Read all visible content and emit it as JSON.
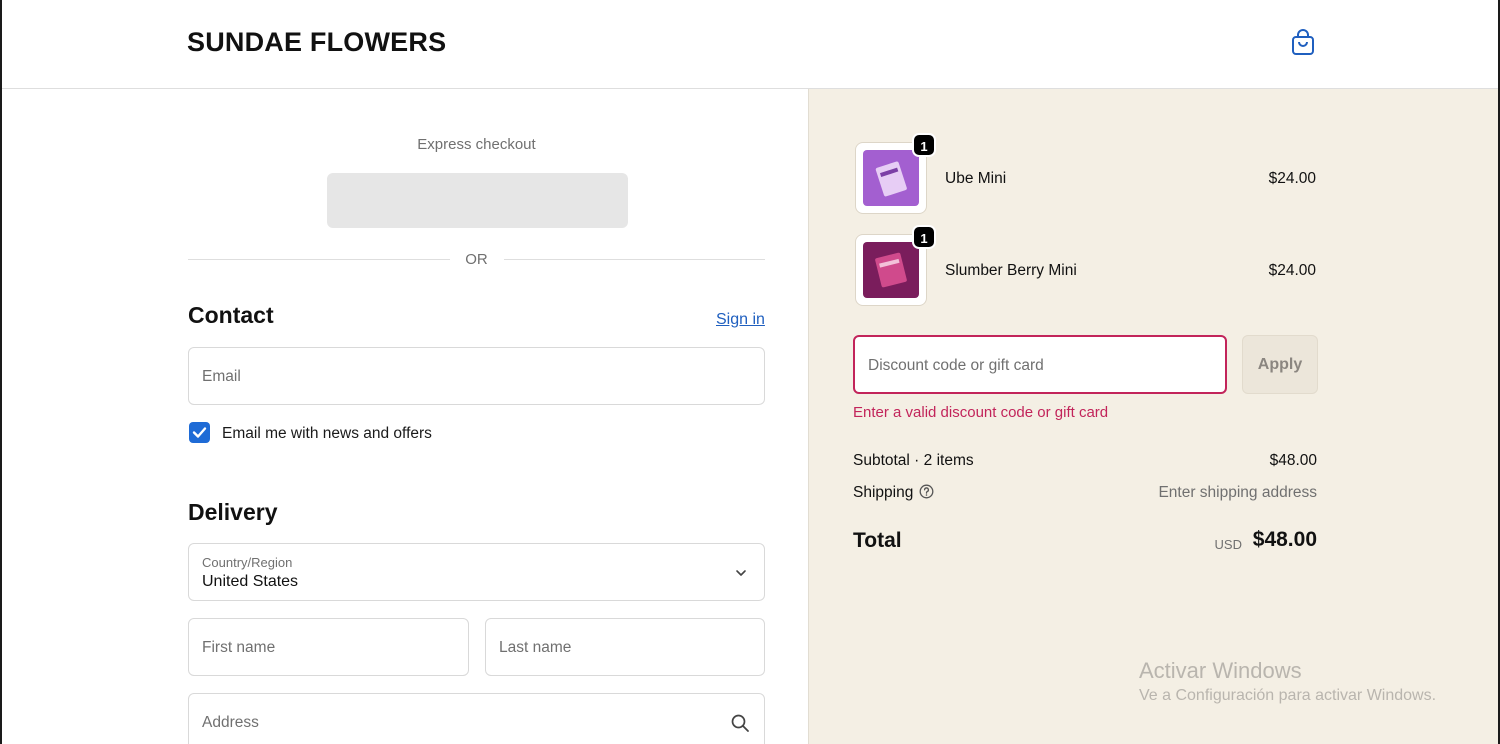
{
  "header": {
    "brand": "SUNDAE FLOWERS",
    "cart_icon": "shopping-bag-icon"
  },
  "express": {
    "label": "Express checkout",
    "or_label": "OR"
  },
  "contact": {
    "title": "Contact",
    "sign_in_label": "Sign in",
    "email_placeholder": "Email",
    "newsletter_label": "Email me with news and offers",
    "newsletter_checked": true
  },
  "delivery": {
    "title": "Delivery",
    "country_label": "Country/Region",
    "country_value": "United States",
    "first_name_placeholder": "First name",
    "last_name_placeholder": "Last name",
    "address_placeholder": "Address"
  },
  "order": {
    "items": [
      {
        "name": "Ube Mini",
        "price": "$24.00",
        "quantity": "1",
        "thumb_color": "#a35fd0"
      },
      {
        "name": "Slumber Berry Mini",
        "price": "$24.00",
        "quantity": "1",
        "thumb_color": "#7a1d5c"
      }
    ],
    "discount_placeholder": "Discount code or gift card",
    "apply_label": "Apply",
    "discount_error": "Enter a valid discount code or gift card",
    "subtotal_label": "Subtotal · 2 items",
    "subtotal_value": "$48.00",
    "shipping_label": "Shipping",
    "shipping_value": "Enter shipping address",
    "total_label": "Total",
    "total_currency": "USD",
    "total_value": "$48.00"
  },
  "watermark": {
    "title": "Activar Windows",
    "subtitle": "Ve a Configuración para activar Windows."
  },
  "colors": {
    "accent_blue": "#1e6bd6",
    "error": "#c2245a",
    "summary_bg": "#f4efe4"
  }
}
